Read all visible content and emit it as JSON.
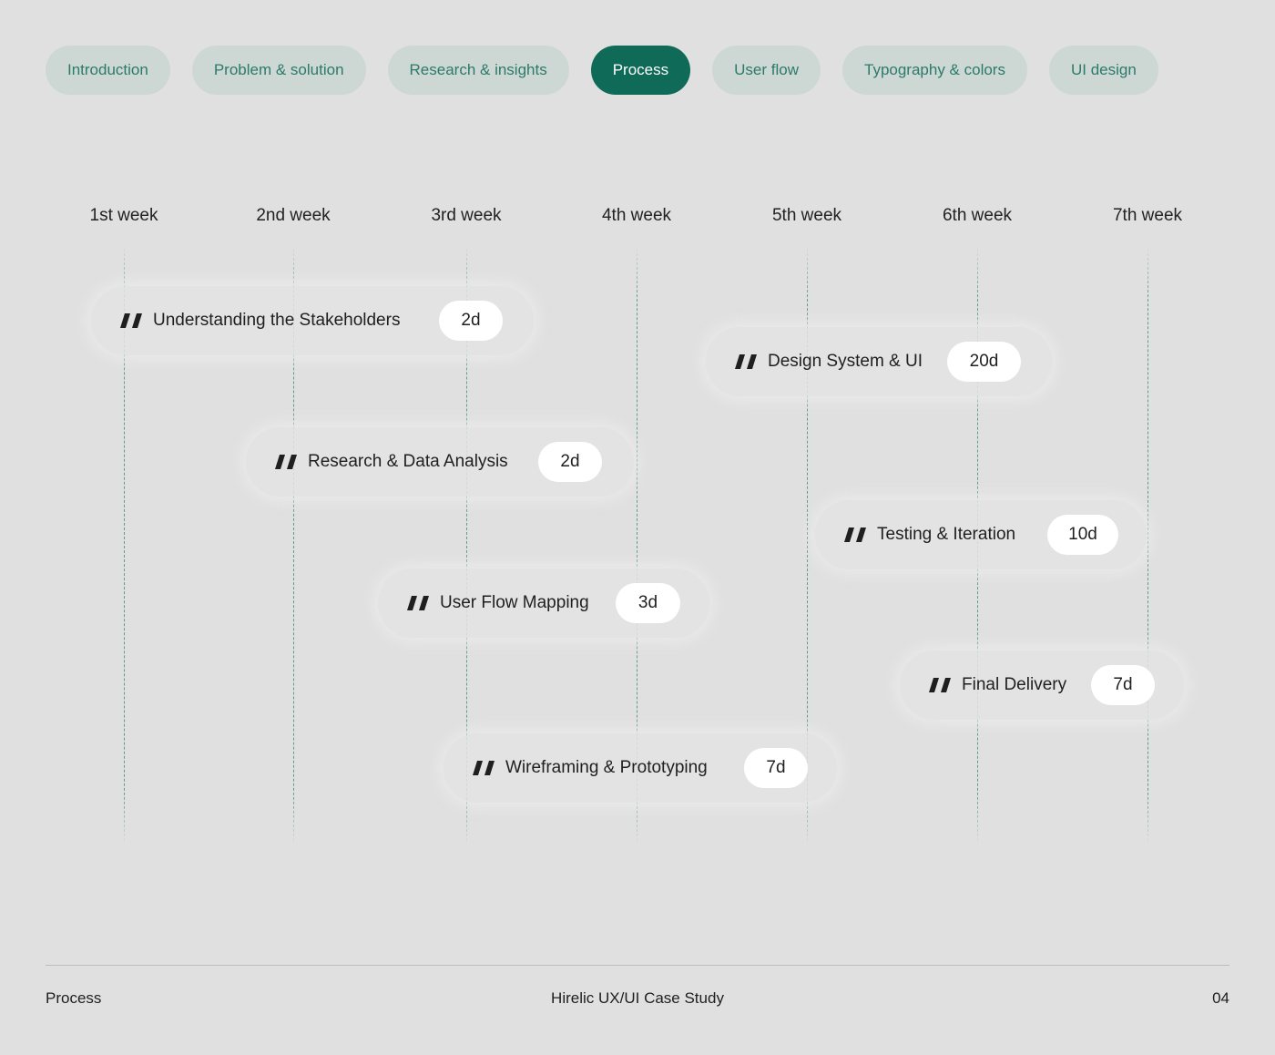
{
  "nav": {
    "tabs": [
      {
        "label": "Introduction"
      },
      {
        "label": "Problem & solution"
      },
      {
        "label": "Research & insights"
      },
      {
        "label": "Process",
        "active": true
      },
      {
        "label": "User flow"
      },
      {
        "label": "Typography & colors"
      },
      {
        "label": "UI design"
      }
    ]
  },
  "timeline": {
    "weeks": [
      "1st week",
      "2nd week",
      "3rd week",
      "4th week",
      "5th week",
      "6th week",
      "7th week"
    ],
    "tasks": [
      {
        "name": "Understanding the Stakeholders",
        "duration": "2d"
      },
      {
        "name": "Design System & UI",
        "duration": "20d"
      },
      {
        "name": "Research & Data Analysis",
        "duration": "2d"
      },
      {
        "name": "Testing & Iteration",
        "duration": "10d"
      },
      {
        "name": "User Flow Mapping",
        "duration": "3d"
      },
      {
        "name": "Final Delivery",
        "duration": "7d"
      },
      {
        "name": "Wireframing & Prototyping",
        "duration": "7d"
      }
    ]
  },
  "colors": {
    "accent": "#0f6b58",
    "tab_bg": "#cdd8d4",
    "tab_text": "#2c7a68",
    "background": "#e0e0e0",
    "gridline": "#5f9c8c"
  },
  "footer": {
    "section": "Process",
    "title": "Hirelic UX/UI Case Study",
    "page": "04"
  }
}
